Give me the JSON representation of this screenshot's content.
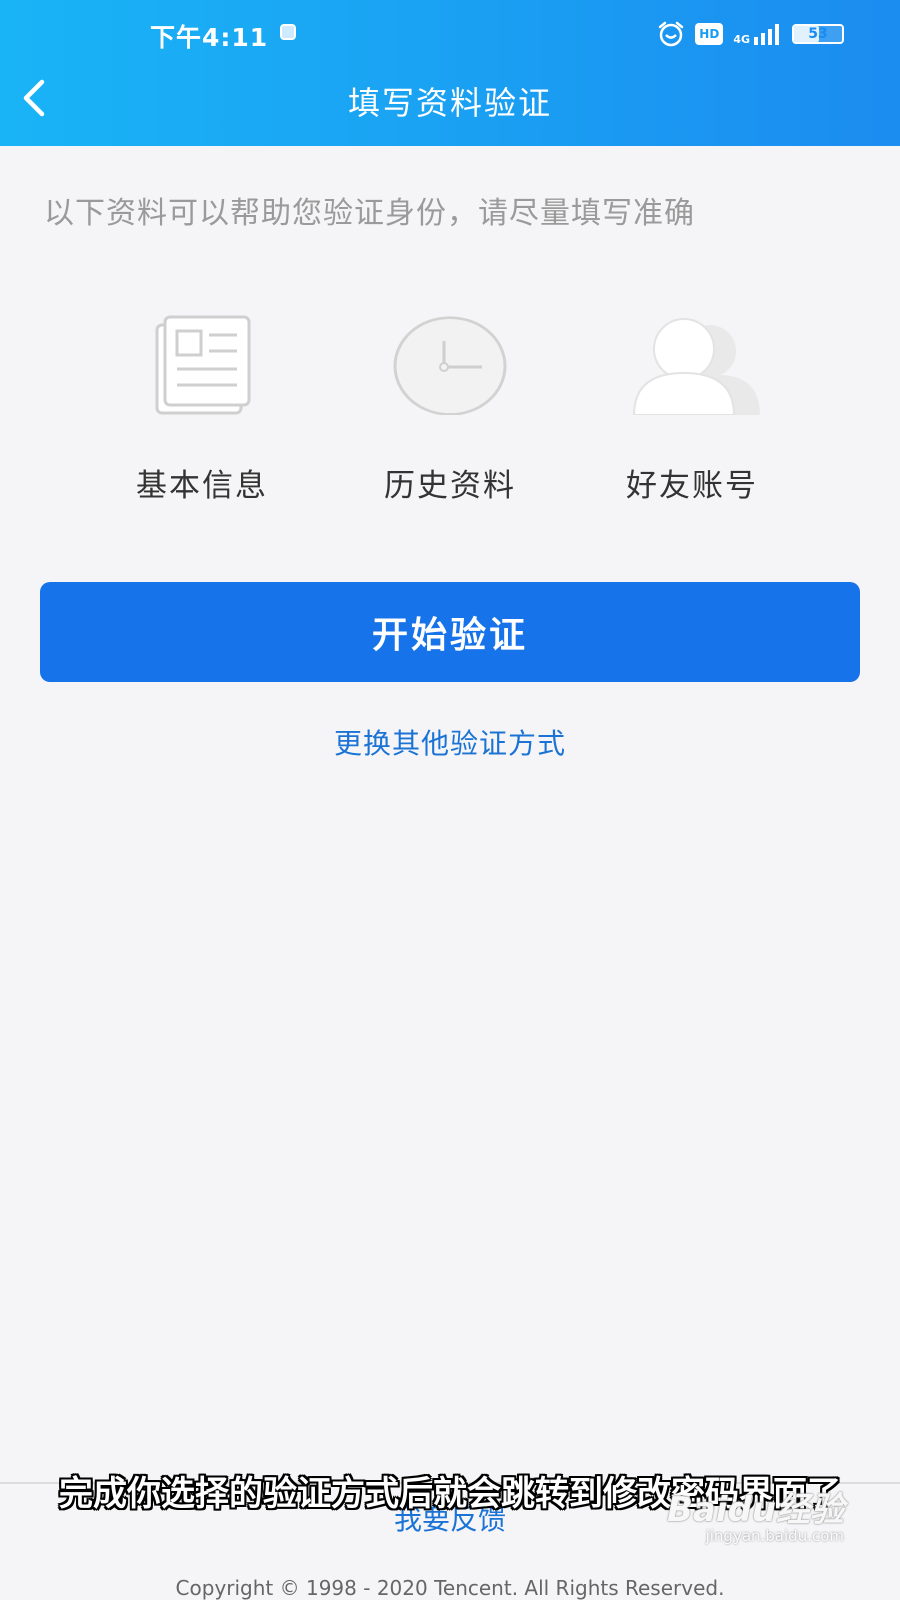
{
  "status_bar": {
    "time": "下午4:11",
    "network": "4G",
    "hd_label": "HD",
    "battery": "53",
    "battery_level": 0.53
  },
  "nav": {
    "title": "填写资料验证",
    "back_icon": "chevron-left-icon"
  },
  "main": {
    "hint": "以下资料可以帮助您验证身份，请尽量填写准确",
    "options": [
      {
        "label": "基本信息",
        "icon": "document-icon"
      },
      {
        "label": "历史资料",
        "icon": "clock-icon"
      },
      {
        "label": "好友账号",
        "icon": "friends-icon"
      }
    ],
    "start_button": "开始验证",
    "switch_link": "更换其他验证方式"
  },
  "footer": {
    "feedback": "我要反馈",
    "copyright": "Copyright © 1998 - 2020 Tencent. All Rights Reserved."
  },
  "overlay": {
    "subtitle": "完成你选择的验证方式后就会跳转到修改密码界面了",
    "watermark": "Baidu经验",
    "watermark_sub": "jingyan.baidu.com"
  },
  "colors": {
    "header_start": "#19b4f6",
    "header_end": "#1b8cf0",
    "primary_button": "#1673ea",
    "link": "#1b73d6",
    "background": "#f5f5f7"
  }
}
